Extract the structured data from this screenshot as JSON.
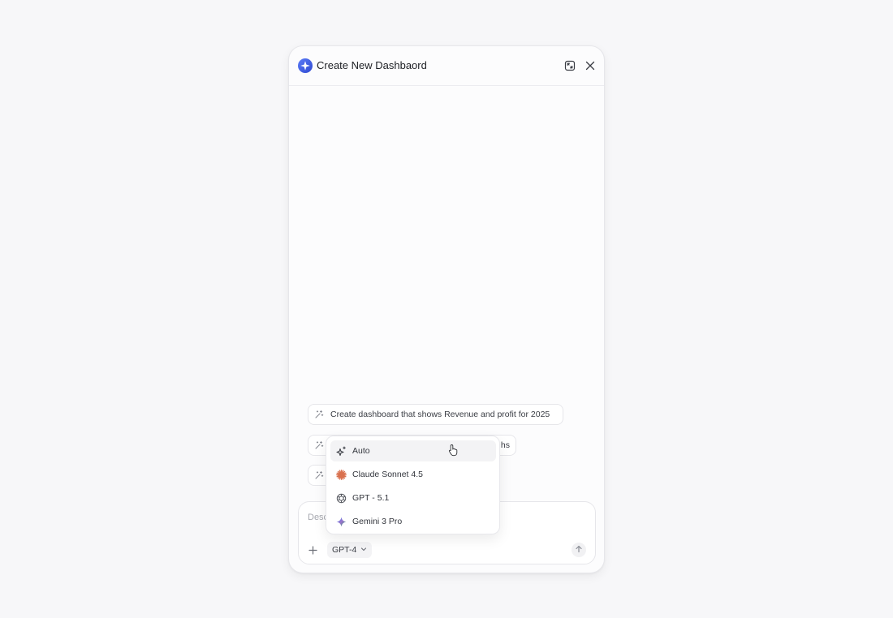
{
  "header": {
    "title": "Create New Dashbaord",
    "logo_icon": "sparkle-logo-icon",
    "expand_icon": "expand-icon",
    "close_icon": "close-icon"
  },
  "suggestions": [
    {
      "label": "Create dashboard that shows Revenue and profit for 2025",
      "icon": "magic-wand-icon"
    },
    {
      "label": "hs",
      "icon": "magic-wand-icon"
    },
    {
      "label": "",
      "icon": "magic-wand-icon"
    }
  ],
  "composer": {
    "placeholder": "Desc",
    "model_label": "GPT-4",
    "plus_icon": "plus-icon",
    "send_icon": "arrow-up-icon"
  },
  "model_menu": {
    "items": [
      {
        "label": "Auto",
        "icon": "sparkles-icon",
        "active": true
      },
      {
        "label": "Claude Sonnet 4.5",
        "icon": "claude-icon",
        "color": "#d9714f"
      },
      {
        "label": "GPT - 5.1",
        "icon": "openai-icon"
      },
      {
        "label": "Gemini 3 Pro",
        "icon": "gemini-icon"
      }
    ]
  },
  "colors": {
    "brand": "#3b5bdb",
    "background": "#f7f7f9",
    "panel": "#fcfcfd"
  }
}
